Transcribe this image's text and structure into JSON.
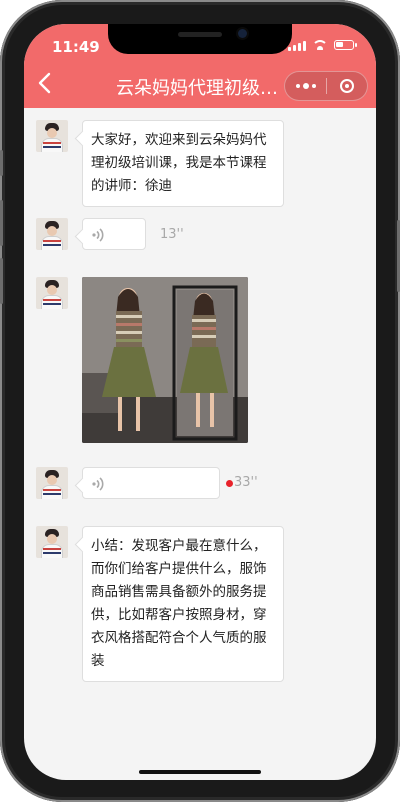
{
  "status_bar": {
    "time": "11:49"
  },
  "header": {
    "title": "云朵妈妈代理初级…",
    "background": "#f26a6a"
  },
  "icons": {
    "back": "chevron-left-icon",
    "more": "more-dots-icon",
    "close": "target-circle-icon",
    "voice": "voice-wave-icon"
  },
  "messages": [
    {
      "type": "text",
      "text": "大家好，欢迎来到云朵妈妈代理初级培训课，我是本节课程的讲师：徐迪"
    },
    {
      "type": "voice",
      "duration": "13''"
    },
    {
      "type": "image",
      "alt_icon": "dress-photo"
    },
    {
      "type": "voice",
      "duration": "33''",
      "unread": true
    },
    {
      "type": "text",
      "text": "小结：发现客户最在意什么，而你们给客户提供什么，服饰商品销售需具备额外的服务提供，比如帮客户按照身材，穿衣风格搭配符合个人气质的服装"
    }
  ]
}
